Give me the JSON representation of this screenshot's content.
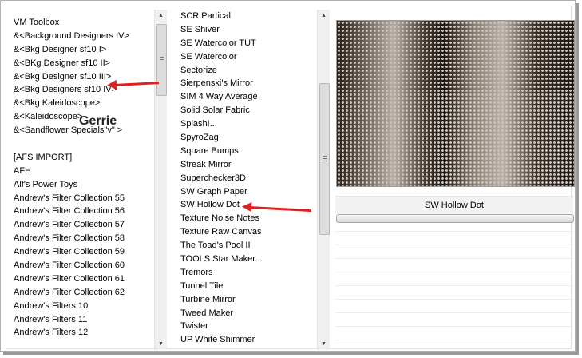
{
  "left_list": {
    "items": [
      " VM Toolbox",
      "&<Background Designers IV>",
      "&<Bkg Designer sf10 I>",
      "&<BKg Designer sf10 II>",
      "&<Bkg Designer sf10 III>",
      "&<Bkg Designers sf10 IV>",
      "&<Bkg Kaleidoscope>",
      "&<Kaleidoscope>",
      "&<Sandflower Specials\"v\" >",
      "",
      "[AFS IMPORT]",
      "AFH",
      "Alf's Power Toys",
      "Andrew's Filter Collection 55",
      "Andrew's Filter Collection 56",
      "Andrew's Filter Collection 57",
      "Andrew's Filter Collection 58",
      "Andrew's Filter Collection 59",
      "Andrew's Filter Collection 60",
      "Andrew's Filter Collection 61",
      "Andrew's Filter Collection 62",
      "Andrew's Filters 10",
      "Andrew's Filters 11",
      "Andrew's Filters 12"
    ]
  },
  "middle_list": {
    "items": [
      "SCR  Partical",
      "SE Shiver",
      "SE Watercolor TUT",
      "SE Watercolor",
      "Sectorize",
      "Sierpenski's Mirror",
      "SIM 4 Way Average",
      "Solid Solar Fabric",
      "Splash!...",
      "SpyroZag",
      "Square Bumps",
      "Streak Mirror",
      "Superchecker3D",
      "SW Graph Paper",
      "SW Hollow Dot",
      "Texture Noise Notes",
      "Texture Raw Canvas",
      "The Toad's Pool II",
      "TOOLS Star Maker...",
      "Tremors",
      "Tunnel Tile",
      "Turbine Mirror",
      "Tweed Maker",
      "Twister",
      "UP White Shimmer"
    ]
  },
  "selected_filter_label": "SW Hollow Dot",
  "annotation_text": "Gerrie",
  "scroll_icons": {
    "up": "up-arrow-icon",
    "down": "down-arrow-icon"
  },
  "colors": {
    "annotation_arrow": "#e02020",
    "preview_dark": "#2a211c",
    "preview_light": "#c9c2ba"
  }
}
